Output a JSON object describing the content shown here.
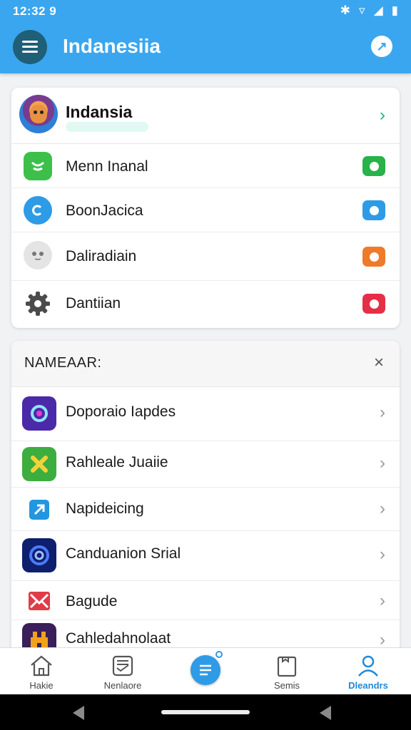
{
  "status_bar": {
    "time": "12:32 9",
    "bluetooth": "bluetooth-icon",
    "wifi": "wifi-icon",
    "signal": "signal-icon",
    "battery": "battery-icon"
  },
  "app_bar": {
    "title": "Indanesiia",
    "menu_icon": "hamburger-menu-icon",
    "help_icon": "help-icon"
  },
  "profile": {
    "name": "Indansia",
    "avatar": "avatar-illustration"
  },
  "settings": [
    {
      "label": "Menn Inanal",
      "icon": "chat-bubble-icon",
      "icon_color": "#3cc04a",
      "toggle_color": "#27b24a"
    },
    {
      "label": "BoonJacica",
      "icon": "shield-icon",
      "icon_color": "#2e9be6",
      "toggle_color": "#2e9be6"
    },
    {
      "label": "Daliradiain",
      "icon": "face-icon",
      "icon_color": "#e4e4e4",
      "toggle_color": "#ee7a2a"
    },
    {
      "label": "Dantiian",
      "icon": "gear-icon",
      "icon_color": "#4b4b4b",
      "toggle_color": "#e52f47"
    }
  ],
  "apps_section": {
    "title": "NAMEAAR:",
    "close_icon": "close-icon",
    "items": [
      {
        "label": "Doporaio Iapdes",
        "icon": "ring-app-icon",
        "color": "#4a2aa8"
      },
      {
        "label": "Rahleale Juaiie",
        "icon": "x-app-icon",
        "color": "#3cae3f"
      },
      {
        "label": "Napideicing",
        "icon": "box-arrow-app-icon",
        "color": "#2496de"
      },
      {
        "label": "Canduanion Srial",
        "icon": "target-app-icon",
        "color": "#0e1f6e"
      },
      {
        "label": "Bagude",
        "icon": "envelope-app-icon",
        "color": "#e23b48"
      },
      {
        "label": "Cahledahnolaat",
        "icon": "castle-app-icon",
        "color": "#f0a21c"
      }
    ]
  },
  "bottom_nav": [
    {
      "label": "Hakie",
      "icon": "home-icon",
      "active": false
    },
    {
      "label": "Nenlaore",
      "icon": "inbox-icon",
      "active": false
    },
    {
      "label": "",
      "icon": "compose-fab-icon",
      "active": false
    },
    {
      "label": "Semis",
      "icon": "clipboard-icon",
      "active": false
    },
    {
      "label": "Dleandrs",
      "icon": "profile-icon",
      "active": true
    }
  ],
  "colors": {
    "accent": "#3aa6ef",
    "active_nav": "#1d8ad8"
  }
}
